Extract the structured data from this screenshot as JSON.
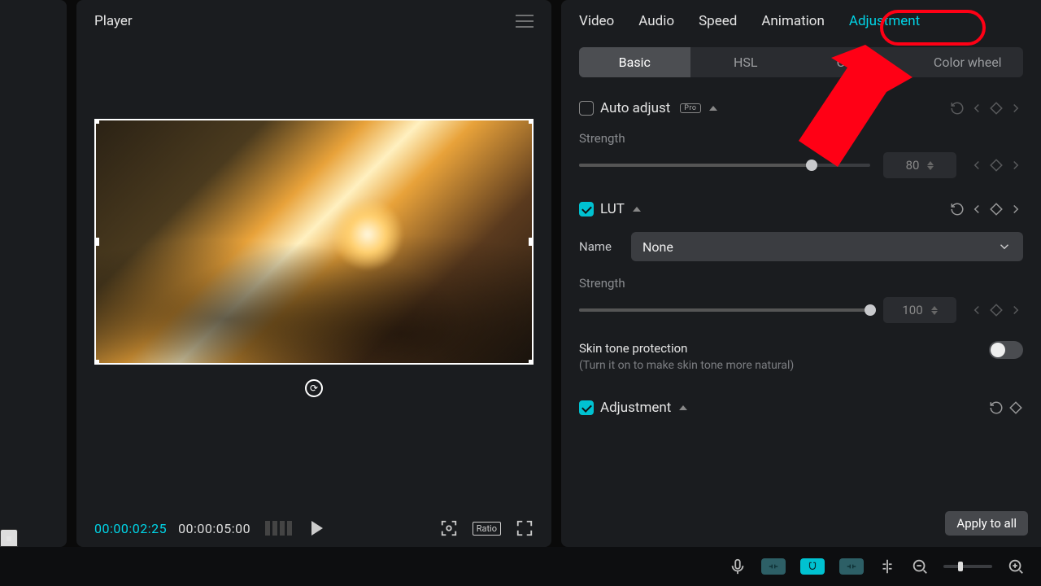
{
  "player": {
    "title": "Player",
    "current_tc": "00:00:02:25",
    "total_tc": "00:00:05:00",
    "ratio_label": "Ratio"
  },
  "tabs": {
    "video": "Video",
    "audio": "Audio",
    "speed": "Speed",
    "animation": "Animation",
    "adjustment": "Adjustment",
    "active": "adjustment"
  },
  "subtabs": {
    "basic": "Basic",
    "hsl": "HSL",
    "curves": "Curves",
    "color_wheel": "Color wheel",
    "active": "basic"
  },
  "auto_adjust": {
    "label": "Auto adjust",
    "badge": "Pro",
    "enabled": false,
    "strength_label": "Strength",
    "strength_value": 80,
    "strength_pct": 80
  },
  "lut": {
    "label": "LUT",
    "enabled": true,
    "name_label": "Name",
    "name_value": "None",
    "strength_label": "Strength",
    "strength_value": 100,
    "strength_pct": 100,
    "skin_label": "Skin tone protection",
    "skin_hint": "(Turn it on to make skin tone more natural)",
    "skin_on": false
  },
  "adjustment_section": {
    "label": "Adjustment",
    "enabled": true
  },
  "apply_all_label": "Apply to all",
  "annotation": {
    "target": "adjustment-tab",
    "color": "#ff0015"
  }
}
